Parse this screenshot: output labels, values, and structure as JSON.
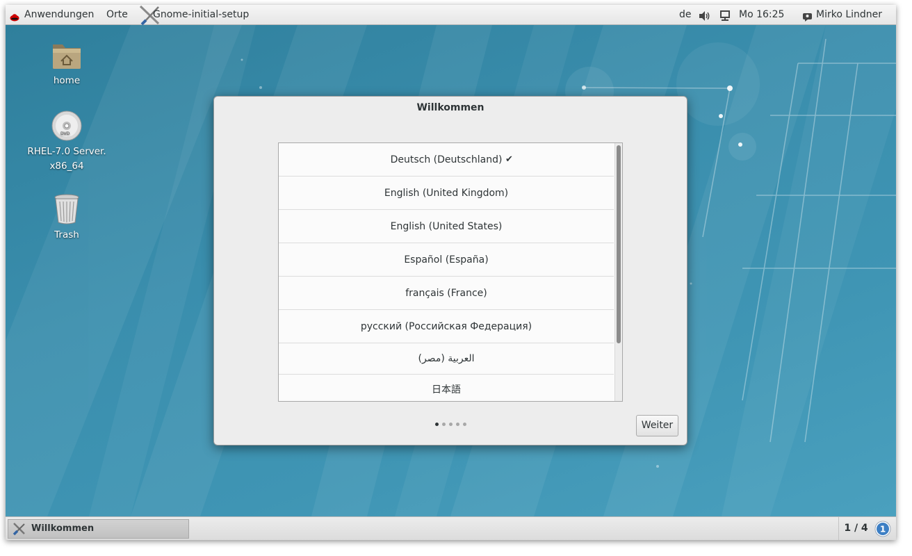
{
  "topbar": {
    "apps_label": "Anwendungen",
    "places_label": "Orte",
    "app_menu_label": "Gnome-initial-setup",
    "keyboard_layout": "de",
    "clock": "Mo 16:25",
    "user_name": "Mirko Lindner"
  },
  "desktop": {
    "icons": [
      {
        "label": "home"
      },
      {
        "label_line1": "RHEL-7.0 Server.",
        "label_line2": "x86_64"
      },
      {
        "label": "Trash"
      }
    ]
  },
  "dialog": {
    "title": "Willkommen",
    "languages": [
      {
        "name": "Deutsch (Deutschland)",
        "checked": true
      },
      {
        "name": "English (United Kingdom)",
        "checked": false
      },
      {
        "name": "English (United States)",
        "checked": false
      },
      {
        "name": "Español (España)",
        "checked": false
      },
      {
        "name": "français (France)",
        "checked": false
      },
      {
        "name": "русский (Российская Федерация)",
        "checked": false
      },
      {
        "name": "العربية (مصر)",
        "checked": false
      },
      {
        "name": "日本語",
        "checked": false
      }
    ],
    "check_glyph": "✔",
    "pages_total": 5,
    "pages_current": 1,
    "next_label": "Weiter"
  },
  "bottombar": {
    "task_label": "Willkommen",
    "workspace": "1 / 4",
    "notification_count": "1"
  },
  "colors": {
    "desktop": "#3a8aa6",
    "topbar": "#eeeeee",
    "text": "#2e3436",
    "badge": "#3d7fc4"
  }
}
